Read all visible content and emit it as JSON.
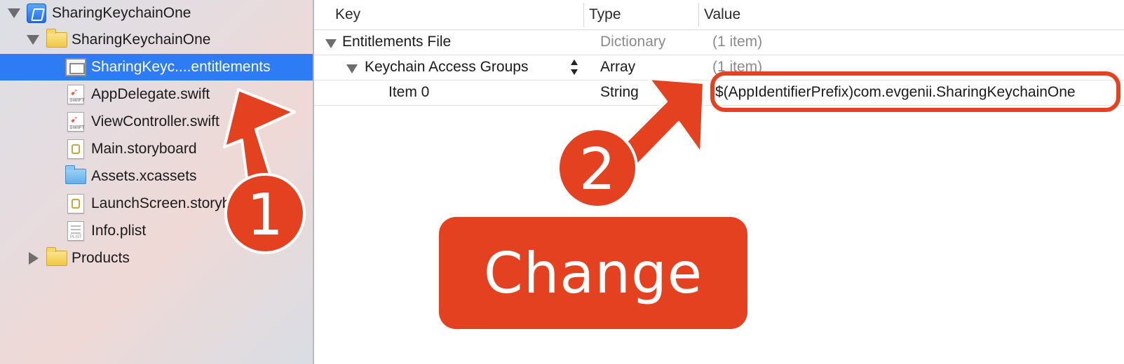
{
  "navigator": {
    "items": [
      {
        "label": "SharingKeychainOne",
        "icon": "xcode-project-icon"
      },
      {
        "label": "SharingKeychainOne",
        "icon": "folder-icon"
      },
      {
        "label": "SharingKeyc....entitlements",
        "icon": "entitlements-file-icon"
      },
      {
        "label": "AppDelegate.swift",
        "icon": "swift-file-icon"
      },
      {
        "label": "ViewController.swift",
        "icon": "swift-file-icon"
      },
      {
        "label": "Main.storyboard",
        "icon": "storyboard-file-icon"
      },
      {
        "label": "Assets.xcassets",
        "icon": "asset-catalog-icon"
      },
      {
        "label": "LaunchScreen.storyboard",
        "icon": "storyboard-file-icon"
      },
      {
        "label": "Info.plist",
        "icon": "plist-file-icon"
      },
      {
        "label": "Products",
        "icon": "folder-icon"
      }
    ],
    "swift_badge": "SWIFT",
    "plist_badge": "PLIST",
    "selected_color": "#2d7cf6"
  },
  "editor": {
    "columns": [
      "Key",
      "Type",
      "Value"
    ],
    "rows": [
      {
        "key": "Entitlements File",
        "type": "Dictionary",
        "value": "(1 item)"
      },
      {
        "key": "Keychain Access Groups",
        "type": "Array",
        "value": "(1 item)"
      },
      {
        "key": "Item 0",
        "type": "String",
        "value": "$(AppIdentifierPrefix)com.evgenii.SharingKeychainOne"
      }
    ]
  },
  "annotations": {
    "step1": "1",
    "step2": "2",
    "change_label": "Change",
    "accent_color": "#e44120"
  }
}
